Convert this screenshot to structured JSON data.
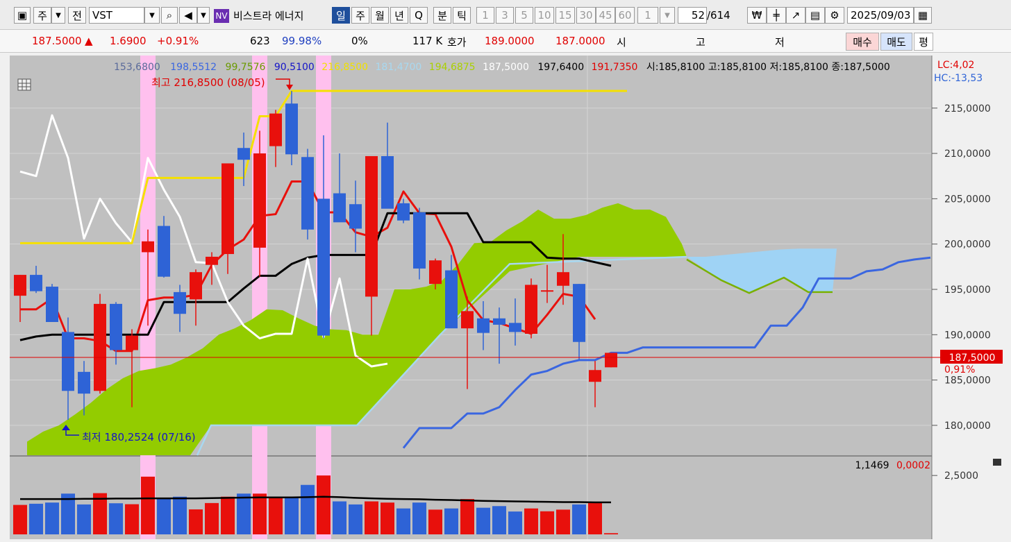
{
  "toolbar": {
    "period_a": "주",
    "jeon_label": "전",
    "symbol": "VST",
    "nv_badge": "NV",
    "stock_name": "비스트라 에너지",
    "periods": [
      "일",
      "주",
      "월",
      "년",
      "Q",
      "분",
      "틱"
    ],
    "minute_options": [
      "1",
      "3",
      "5",
      "10",
      "15",
      "30",
      "45",
      "60"
    ],
    "count_value": "1",
    "position": "52",
    "total": "/614",
    "date": "2025/09/03"
  },
  "quote": {
    "price": "187.5000",
    "arrow": "▲",
    "change": "1.6900",
    "change_pct": "+0.91%",
    "v1": "623",
    "v2": "99.98%",
    "v3": "0%",
    "volume": "117 K",
    "hoga_label": "호가",
    "ask": "189.0000",
    "bid": "187.0000",
    "open_label": "시",
    "high_label": "고",
    "low_label": "저",
    "buy_label": "매수",
    "sell_label": "매도",
    "eval_label": "평"
  },
  "legend": [
    {
      "text": "153,6800",
      "color": "#5a6a9a"
    },
    {
      "text": "198,5512",
      "color": "#3a66e0"
    },
    {
      "text": "99,7576",
      "color": "#6a9a00"
    },
    {
      "text": "90,5100",
      "color": "#1414c8"
    },
    {
      "text": "216,8500",
      "color": "#f0e000"
    },
    {
      "text": "181,4700",
      "color": "#a8d8f0"
    },
    {
      "text": "194,6875",
      "color": "#aad000"
    },
    {
      "text": "187,5000",
      "color": "#ffffff"
    },
    {
      "text": "197,6400",
      "color": "#000000"
    },
    {
      "text": "191,7350",
      "color": "#e00000"
    }
  ],
  "ohlc_text": "시:185,8100 고:185,8100 저:185,8100 종:187,5000",
  "lc_text": "LC:4,02",
  "hc_text": "HC:-13,53",
  "high_marker": "최고 216,8500 (08/05)",
  "low_marker": "최저 180,2524 (07/16)",
  "current_price_label": "187,5000",
  "current_pct_label": "0,91%",
  "volume_pane_values": {
    "a": "1,1469",
    "b": "0,0002"
  },
  "colors": {
    "up": "#e8100c",
    "down": "#2e63d6",
    "cloud_green": "#93cc00",
    "cloud_blue": "#9fd3f5",
    "highlight": "#ffc0ee"
  },
  "chart_data": {
    "type": "candlestick",
    "price_axis": {
      "ticks": [
        180,
        185,
        190,
        195,
        200,
        205,
        210,
        215
      ],
      "tick_labels": [
        "180,0000",
        "185,0000",
        "190,0000",
        "195,0000",
        "200,0000",
        "205,0000",
        "210,0000",
        "215,0000"
      ],
      "range": [
        176.7,
        220.8
      ]
    },
    "volume_axis": {
      "ticks": [
        2.5
      ],
      "tick_labels": [
        "2,5000"
      ],
      "range": [
        0,
        3.3
      ]
    },
    "candles": [
      {
        "o": 194.3,
        "h": 196.6,
        "l": 191.4,
        "c": 196.6
      },
      {
        "o": 196.6,
        "h": 197.6,
        "l": 194.6,
        "c": 194.8
      },
      {
        "o": 195.3,
        "h": 195.6,
        "l": 191.8,
        "c": 191.4
      },
      {
        "o": 190.3,
        "h": 191.9,
        "l": 180.6,
        "c": 183.8
      },
      {
        "o": 185.9,
        "h": 187.1,
        "l": 181.1,
        "c": 183.5
      },
      {
        "o": 183.8,
        "h": 194.5,
        "l": 183.5,
        "c": 193.4
      },
      {
        "o": 193.4,
        "h": 193.6,
        "l": 186.7,
        "c": 188.3
      },
      {
        "o": 188.3,
        "h": 190.6,
        "l": 182.0,
        "c": 189.9
      },
      {
        "o": 199.1,
        "h": 201.6,
        "l": 191.0,
        "c": 200.3
      },
      {
        "o": 202.0,
        "h": 203.1,
        "l": 196.3,
        "c": 196.4
      },
      {
        "o": 194.7,
        "h": 195.5,
        "l": 190.3,
        "c": 192.3
      },
      {
        "o": 193.9,
        "h": 197.2,
        "l": 191.0,
        "c": 196.9
      },
      {
        "o": 197.7,
        "h": 199.1,
        "l": 195.5,
        "c": 198.6
      },
      {
        "o": 198.9,
        "h": 207.4,
        "l": 196.7,
        "c": 208.9
      },
      {
        "o": 210.6,
        "h": 212.3,
        "l": 206.4,
        "c": 209.3
      },
      {
        "o": 199.6,
        "h": 212.5,
        "l": 196.4,
        "c": 210.0
      },
      {
        "o": 210.8,
        "h": 214.8,
        "l": 208.5,
        "c": 214.4
      },
      {
        "o": 215.5,
        "h": 216.9,
        "l": 208.7,
        "c": 209.9
      },
      {
        "o": 209.6,
        "h": 210.5,
        "l": 200.5,
        "c": 201.6
      },
      {
        "o": 205.0,
        "h": 212.0,
        "l": 189.6,
        "c": 189.9
      },
      {
        "o": 205.6,
        "h": 210.0,
        "l": 202.5,
        "c": 202.4
      },
      {
        "o": 204.4,
        "h": 207.0,
        "l": 199.1,
        "c": 201.7
      },
      {
        "o": 194.2,
        "h": 209.6,
        "l": 189.9,
        "c": 209.7
      },
      {
        "o": 209.7,
        "h": 213.4,
        "l": 204.0,
        "c": 203.9
      },
      {
        "o": 204.5,
        "h": 205.0,
        "l": 202.3,
        "c": 202.6
      },
      {
        "o": 203.5,
        "h": 204.0,
        "l": 196.1,
        "c": 197.3
      },
      {
        "o": 195.6,
        "h": 198.4,
        "l": 195.0,
        "c": 198.2
      },
      {
        "o": 197.1,
        "h": 198.8,
        "l": 190.8,
        "c": 190.7
      },
      {
        "o": 190.7,
        "h": 194.2,
        "l": 184.0,
        "c": 192.6
      },
      {
        "o": 191.8,
        "h": 193.7,
        "l": 188.3,
        "c": 190.2
      },
      {
        "o": 191.8,
        "h": 193.0,
        "l": 186.8,
        "c": 191.1
      },
      {
        "o": 191.3,
        "h": 194.0,
        "l": 188.8,
        "c": 190.3
      },
      {
        "o": 190.1,
        "h": 196.2,
        "l": 189.6,
        "c": 195.5
      },
      {
        "o": 194.9,
        "h": 197.7,
        "l": 193.5,
        "c": 194.9
      },
      {
        "o": 195.4,
        "h": 201.1,
        "l": 193.3,
        "c": 196.9
      },
      {
        "o": 195.6,
        "h": 195.6,
        "l": 187.2,
        "c": 189.2
      },
      {
        "o": 184.8,
        "h": 187.1,
        "l": 182.0,
        "c": 186.1
      },
      {
        "o": 186.4,
        "h": 187.8,
        "l": 186.4,
        "c": 188.0
      }
    ],
    "highlight_indices": [
      8,
      15,
      19
    ],
    "series": [
      {
        "color": "#e8100c",
        "values": [
          192.8,
          192.8,
          194.0,
          189.6,
          189.6,
          189.3,
          188.2,
          188.2,
          193.8,
          194.1,
          194.1,
          194.4,
          197.7,
          199.4,
          200.5,
          203.1,
          203.3,
          206.9,
          206.9,
          203.5,
          203.5,
          201.3,
          200.8,
          201.8,
          205.8,
          203.4,
          203.3,
          199.7,
          193.8,
          191.6,
          191.3,
          190.7,
          190.1,
          192.2,
          194.5,
          194.2,
          191.7
        ]
      },
      {
        "color": "#000000",
        "values": [
          189.4,
          189.8,
          190.0,
          190.0,
          190.0,
          190.0,
          190.0,
          190.0,
          190.0,
          193.6,
          193.6,
          193.6,
          193.6,
          193.6,
          195.1,
          196.5,
          196.5,
          197.8,
          198.5,
          198.8,
          198.8,
          198.8,
          198.8,
          203.4,
          203.4,
          203.4,
          203.4,
          203.4,
          203.4,
          200.2,
          200.2,
          200.2,
          200.2,
          198.5,
          198.4,
          198.4,
          198.0,
          197.6
        ]
      },
      {
        "color": "#ffffff",
        "values": [
          208.0,
          207.5,
          214.2,
          209.5,
          200.6,
          205.0,
          202.3,
          200.2,
          209.5,
          206.0,
          203.0,
          198.0,
          197.9,
          193.6,
          191.0,
          189.6,
          190.1,
          190.1,
          198.4,
          189.7,
          196.2,
          187.7,
          186.5,
          186.8
        ]
      },
      {
        "color": "#f5e000",
        "values": [
          200.1,
          200.1,
          200.1,
          200.1,
          200.1,
          200.1,
          200.1,
          200.1,
          207.3,
          207.3,
          207.3,
          207.3,
          207.3,
          207.3,
          207.3,
          214.1,
          214.1,
          216.9,
          216.9,
          216.9,
          216.9,
          216.9,
          216.9,
          216.9,
          216.9,
          216.9,
          216.9,
          216.9,
          216.9,
          216.9,
          216.9,
          216.9,
          216.9,
          216.9,
          216.9,
          216.9,
          216.9,
          216.9,
          216.9
        ]
      },
      {
        "color": "#3a66e0",
        "values": [
          177.5,
          179.7,
          179.7,
          179.7,
          181.3,
          181.3,
          182.0,
          183.9,
          185.6,
          186.0,
          186.8,
          187.2,
          187.2,
          188.0,
          188.0,
          188.6,
          188.6,
          188.6,
          188.6,
          188.6,
          188.6,
          188.6,
          188.6,
          191.0,
          191.0,
          193.0,
          196.2,
          196.2,
          196.2,
          197.0,
          197.2,
          198.0,
          198.3,
          198.5
        ]
      }
    ],
    "cloud_green_top": [
      178.2,
      179.3,
      180.0,
      181.2,
      182.5,
      184.0,
      185.2,
      186.0,
      186.3,
      186.7,
      187.5,
      188.5,
      190.0,
      190.7,
      191.6,
      192.8,
      192.7,
      191.8,
      191.0,
      190.6,
      190.5,
      190.0,
      190.0,
      195.0,
      195.0,
      195.3,
      196.0,
      197.8,
      200.1,
      200.2,
      201.5,
      202.5,
      203.8,
      202.8,
      202.8,
      203.2,
      204.0,
      204.5,
      203.8,
      203.8,
      203.0,
      200.0
    ],
    "cloud_blue": [
      198.6,
      198.6,
      198.8,
      199.0,
      199.2,
      199.4,
      199.5,
      199.5,
      199.5
    ],
    "volume": [
      {
        "v": 1.25,
        "up": true
      },
      {
        "v": 1.3,
        "up": false
      },
      {
        "v": 1.35,
        "up": false
      },
      {
        "v": 1.73,
        "up": false
      },
      {
        "v": 1.27,
        "up": false
      },
      {
        "v": 1.75,
        "up": true
      },
      {
        "v": 1.32,
        "up": false
      },
      {
        "v": 1.28,
        "up": true
      },
      {
        "v": 2.45,
        "up": true
      },
      {
        "v": 1.56,
        "up": false
      },
      {
        "v": 1.6,
        "up": false
      },
      {
        "v": 1.06,
        "up": true
      },
      {
        "v": 1.33,
        "up": true
      },
      {
        "v": 1.6,
        "up": true
      },
      {
        "v": 1.73,
        "up": false
      },
      {
        "v": 1.73,
        "up": true
      },
      {
        "v": 1.58,
        "up": true
      },
      {
        "v": 1.56,
        "up": false
      },
      {
        "v": 2.1,
        "up": false
      },
      {
        "v": 2.5,
        "up": true
      },
      {
        "v": 1.4,
        "up": false
      },
      {
        "v": 1.27,
        "up": false
      },
      {
        "v": 1.4,
        "up": true
      },
      {
        "v": 1.35,
        "up": true
      },
      {
        "v": 1.1,
        "up": false
      },
      {
        "v": 1.35,
        "up": false
      },
      {
        "v": 1.05,
        "up": true
      },
      {
        "v": 1.1,
        "up": false
      },
      {
        "v": 1.5,
        "up": true
      },
      {
        "v": 1.13,
        "up": false
      },
      {
        "v": 1.2,
        "up": false
      },
      {
        "v": 0.97,
        "up": false
      },
      {
        "v": 1.1,
        "up": true
      },
      {
        "v": 0.98,
        "up": true
      },
      {
        "v": 1.05,
        "up": true
      },
      {
        "v": 1.27,
        "up": false
      },
      {
        "v": 1.33,
        "up": true
      },
      {
        "v": 0.05,
        "up": true
      }
    ],
    "volume_ma": [
      1.5,
      1.5,
      1.5,
      1.5,
      1.51,
      1.51,
      1.52,
      1.52,
      1.53,
      1.53,
      1.53,
      1.53,
      1.54,
      1.55,
      1.56,
      1.57,
      1.57,
      1.57,
      1.58,
      1.6,
      1.58,
      1.55,
      1.53,
      1.51,
      1.5,
      1.49,
      1.47,
      1.46,
      1.44,
      1.42,
      1.41,
      1.4,
      1.39,
      1.38,
      1.37,
      1.37,
      1.36,
      1.36
    ]
  }
}
